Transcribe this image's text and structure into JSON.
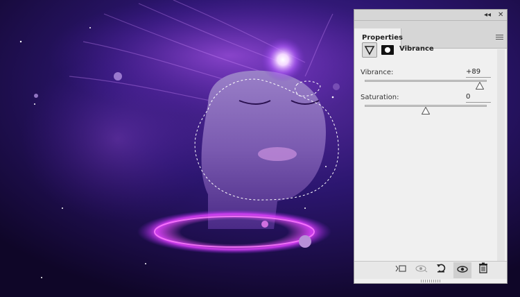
{
  "panel": {
    "tab_label": "Properties",
    "collapse_glyph": "◂◂",
    "close_glyph": "✕",
    "adjustment_name": "Vibrance",
    "vibrance": {
      "label": "Vibrance:",
      "value": "+89",
      "fraction": 0.945
    },
    "saturation": {
      "label": "Saturation:",
      "value": "0",
      "fraction": 0.5
    },
    "bottom_icons": [
      "clip-to-layer-icon",
      "view-previous-icon",
      "reset-icon",
      "visibility-icon",
      "delete-icon"
    ]
  },
  "colors": {
    "panel_bg": "#f0f0f0",
    "accent_magenta": "#d04bff",
    "space_dark": "#1a0b3a"
  }
}
